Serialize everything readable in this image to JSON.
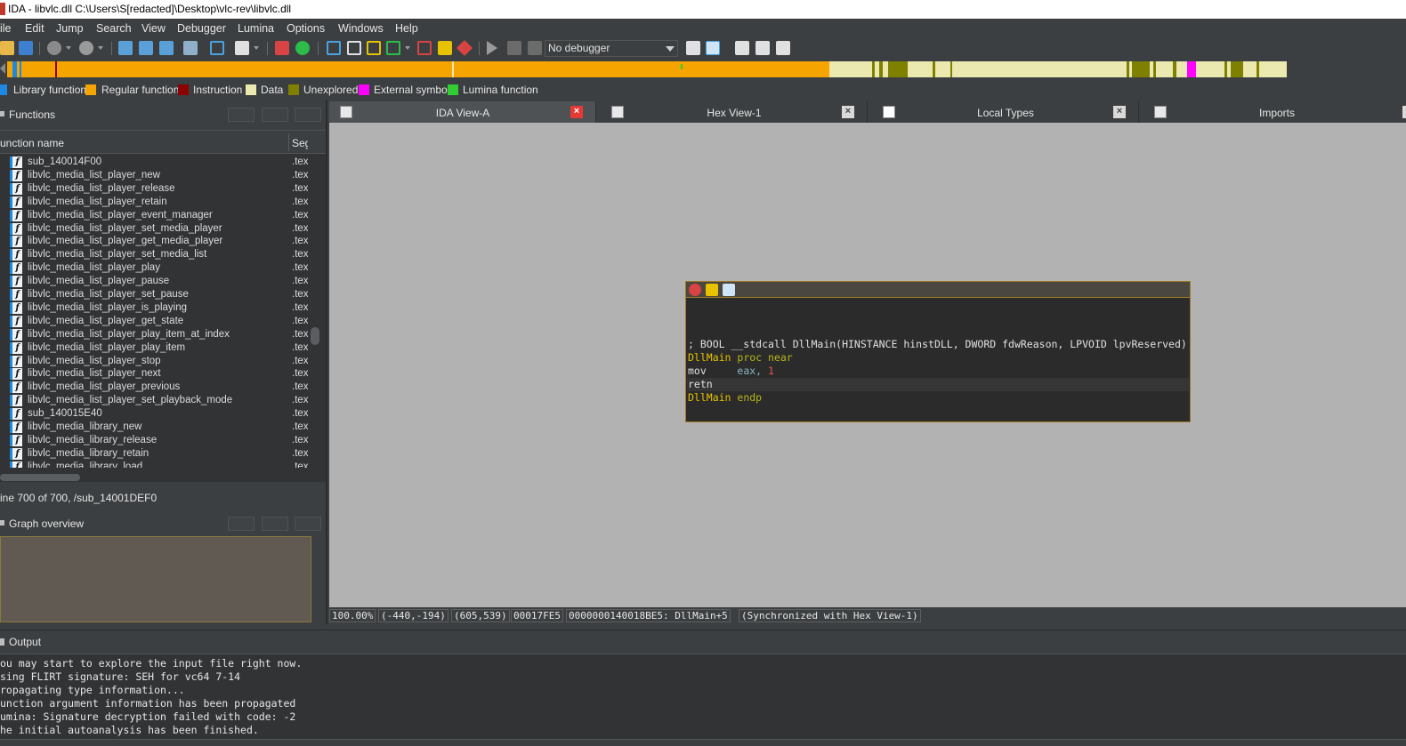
{
  "window": {
    "title": "IDA - libvlc.dll C:\\Users\\S[redacted]\\Desktop\\vlc-rev\\libvlc.dll"
  },
  "menu": [
    "ile",
    "Edit",
    "Jump",
    "Search",
    "View",
    "Debugger",
    "Lumina",
    "Options",
    "Windows",
    "Help"
  ],
  "toolbar": {
    "debugger_select": "No debugger"
  },
  "legend": [
    {
      "label": "Library function",
      "color": "#1e88e5"
    },
    {
      "label": "Regular function",
      "color": "#f5a400"
    },
    {
      "label": "Instruction",
      "color": "#8b0000"
    },
    {
      "label": "Data",
      "color": "#ece9b0"
    },
    {
      "label": "Unexplored",
      "color": "#808000"
    },
    {
      "label": "External symbol",
      "color": "#ff00ff"
    },
    {
      "label": "Lumina function",
      "color": "#32cd32"
    }
  ],
  "functions_panel": {
    "title": "Functions",
    "col_name": "unction name",
    "col_seg": "Seg",
    "rows": [
      {
        "name": "sub_140014F00",
        "seg": ".tex"
      },
      {
        "name": "libvlc_media_list_player_new",
        "seg": ".tex"
      },
      {
        "name": "libvlc_media_list_player_release",
        "seg": ".tex"
      },
      {
        "name": "libvlc_media_list_player_retain",
        "seg": ".tex"
      },
      {
        "name": "libvlc_media_list_player_event_manager",
        "seg": ".tex"
      },
      {
        "name": "libvlc_media_list_player_set_media_player",
        "seg": ".tex"
      },
      {
        "name": "libvlc_media_list_player_get_media_player",
        "seg": ".tex"
      },
      {
        "name": "libvlc_media_list_player_set_media_list",
        "seg": ".tex"
      },
      {
        "name": "libvlc_media_list_player_play",
        "seg": ".tex"
      },
      {
        "name": "libvlc_media_list_player_pause",
        "seg": ".tex"
      },
      {
        "name": "libvlc_media_list_player_set_pause",
        "seg": ".tex"
      },
      {
        "name": "libvlc_media_list_player_is_playing",
        "seg": ".tex"
      },
      {
        "name": "libvlc_media_list_player_get_state",
        "seg": ".tex"
      },
      {
        "name": "libvlc_media_list_player_play_item_at_index",
        "seg": ".tex"
      },
      {
        "name": "libvlc_media_list_player_play_item",
        "seg": ".tex"
      },
      {
        "name": "libvlc_media_list_player_stop",
        "seg": ".tex"
      },
      {
        "name": "libvlc_media_list_player_next",
        "seg": ".tex"
      },
      {
        "name": "libvlc_media_list_player_previous",
        "seg": ".tex"
      },
      {
        "name": "libvlc_media_list_player_set_playback_mode",
        "seg": ".tex"
      },
      {
        "name": "sub_140015E40",
        "seg": ".tex"
      },
      {
        "name": "libvlc_media_library_new",
        "seg": ".tex"
      },
      {
        "name": "libvlc_media_library_release",
        "seg": ".tex"
      },
      {
        "name": "libvlc_media_library_retain",
        "seg": ".tex"
      },
      {
        "name": "libvlc_media_library_load",
        "seg": ".tex"
      }
    ],
    "status": "ine 700 of 700, /sub_14001DEF0"
  },
  "graph_overview": {
    "title": "Graph overview"
  },
  "tabs": [
    {
      "label": "IDA View-A",
      "active": true
    },
    {
      "label": "Hex View-1",
      "active": false
    },
    {
      "label": "Local Types",
      "active": false
    },
    {
      "label": "Imports",
      "active": false
    }
  ],
  "disasm": {
    "comment": "; BOOL __stdcall DllMain(HINSTANCE hinstDLL, DWORD fdwReason, LPVOID lpvReserved)",
    "proc_label": "DllMain",
    "proc_kw": "proc near",
    "mov_op": "mov",
    "mov_reg": "eax,",
    "mov_imm": "1",
    "retn": "retn",
    "endp_label": "DllMain",
    "endp_kw": "endp"
  },
  "status": {
    "zoom": "100.00%",
    "mouse": "(-440,-194)",
    "graph_pos": "(605,539)",
    "file_off": "00017FE5",
    "address": "0000000140018BE5: DllMain+5",
    "sync": "(Synchronized with Hex View-1)"
  },
  "output": {
    "title": "Output",
    "lines": [
      "ou may start to explore the input file right now.",
      "sing FLIRT signature: SEH for vc64 7-14",
      "ropagating type information...",
      "unction argument information has been propagated",
      "umina: Signature decryption failed with code: -2",
      "he initial autoanalysis has been finished."
    ]
  }
}
